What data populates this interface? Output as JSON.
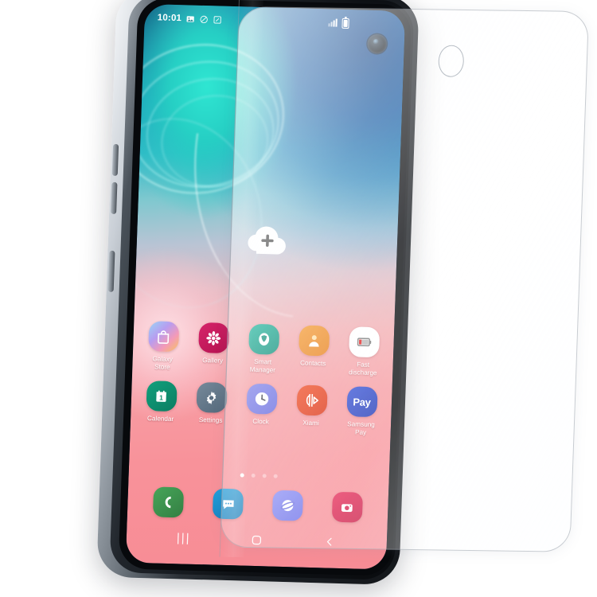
{
  "scene": {
    "title": "Samsung Galaxy S10e with tempered glass screen protector",
    "background_color": "#ffffff"
  },
  "phone": {
    "model_hint": "Galaxy S10e",
    "frame_color": "#1b1f24",
    "side_buttons": [
      "volume-up",
      "volume-down",
      "bixby"
    ]
  },
  "status_bar": {
    "time": "10:01",
    "left_icons": [
      "image-icon",
      "cancel-icon",
      "screenshot-icon"
    ],
    "right_icons": [
      "signal-icon",
      "battery-icon"
    ],
    "text_color": "#ffffff"
  },
  "widget": {
    "name": "cloud-add-widget",
    "icon": "cloud-plus-icon"
  },
  "home_screen": {
    "wallpaper_colors": [
      "#0f4f77",
      "#2fb9c6",
      "#0b3f86",
      "#f79ca2"
    ],
    "apps_row1": [
      {
        "label": "Galaxy\nStore",
        "icon": "galaxy-store-icon",
        "color": "#b49ae8"
      },
      {
        "label": "Gallery",
        "icon": "gallery-flower-icon",
        "color": "#c2185b"
      },
      {
        "label": "Smart\nManager",
        "icon": "smart-manager-shield-icon",
        "color": "#12a08b"
      },
      {
        "label": "Contacts",
        "icon": "contacts-person-icon",
        "color": "#ef8c24"
      },
      {
        "label": "Fast\ndischarge",
        "icon": "battery-discharge-icon",
        "color": "#ffffff"
      }
    ],
    "apps_row2": [
      {
        "label": "Calendar",
        "icon": "calendar-icon",
        "color": "#0f8f6f",
        "badge": "1"
      },
      {
        "label": "Settings",
        "icon": "settings-gear-icon",
        "color": "#64798a"
      },
      {
        "label": "Clock",
        "icon": "clock-icon",
        "color": "#6f72e0"
      },
      {
        "label": "Xiami",
        "icon": "xiami-music-icon",
        "color": "#e8401f"
      },
      {
        "label": "Samsung\nPay",
        "icon": "samsung-pay-icon",
        "color": "#2845c4",
        "text": "Pay"
      }
    ],
    "page_dots": {
      "count": 4,
      "active_index": 0
    },
    "dock": [
      {
        "label": "Phone",
        "icon": "phone-handset-icon",
        "color": "#3d9a4e"
      },
      {
        "label": "Messages",
        "icon": "message-bubble-icon",
        "color": "#1b8fd0"
      },
      {
        "label": "Internet",
        "icon": "internet-browser-icon",
        "color": "#7b7ff0"
      },
      {
        "label": "Camera",
        "icon": "camera-icon",
        "color": "#d81b4a"
      }
    ],
    "nav_bar": [
      {
        "label": "|||",
        "icon": "recents-icon"
      },
      {
        "label": "◻",
        "icon": "home-icon"
      },
      {
        "label": "‹",
        "icon": "back-icon"
      }
    ]
  },
  "protector": {
    "name": "tempered-glass-screen-protector",
    "material": "clear tempered glass",
    "camera_cutout": "punch-hole-cutout",
    "edge_color": "#9ba3ac"
  }
}
